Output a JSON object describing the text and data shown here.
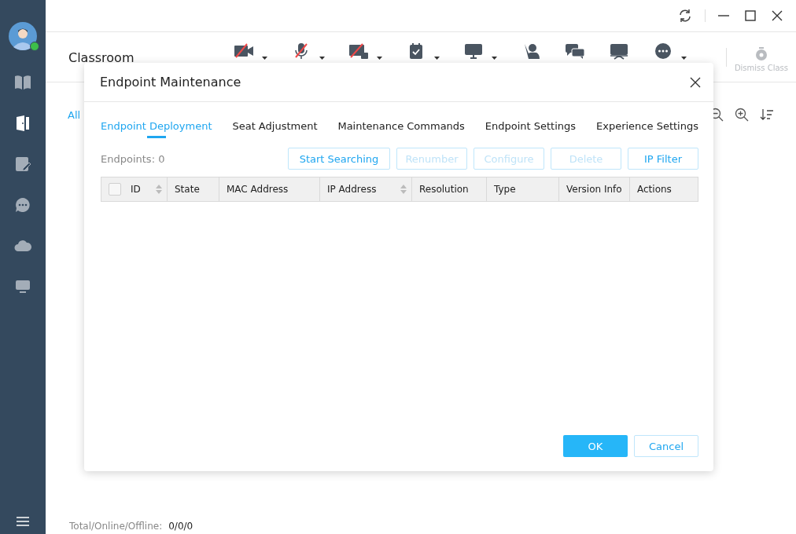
{
  "sidebar": {
    "avatar": {
      "online": true
    },
    "items": [
      {
        "kind": "book",
        "selected": false
      },
      {
        "kind": "door",
        "selected": true
      },
      {
        "kind": "edit",
        "selected": false
      },
      {
        "kind": "chat",
        "selected": false
      },
      {
        "kind": "cloud",
        "selected": false
      },
      {
        "kind": "monitor",
        "selected": false
      }
    ]
  },
  "page": {
    "title": "Classroom",
    "link": "All",
    "toolbar": [
      {
        "kind": "camera-off",
        "dropdown": true
      },
      {
        "kind": "mic-off",
        "dropdown": true
      },
      {
        "kind": "screen-lock",
        "dropdown": true
      },
      {
        "kind": "clipboard",
        "dropdown": true
      },
      {
        "kind": "monitor",
        "dropdown": true
      },
      {
        "kind": "hand",
        "dropdown": false
      },
      {
        "kind": "chat",
        "dropdown": false
      },
      {
        "kind": "projector",
        "dropdown": false
      },
      {
        "kind": "more",
        "dropdown": true
      }
    ],
    "dismiss": {
      "label": "Dismiss Class",
      "disabled": true
    },
    "status": {
      "label": "Total/Online/Offline:",
      "value": "0/0/0"
    }
  },
  "dialog": {
    "title": "Endpoint Maintenance",
    "tabs": [
      {
        "label": "Endpoint Deployment",
        "selected": true
      },
      {
        "label": "Seat Adjustment",
        "selected": false
      },
      {
        "label": "Maintenance Commands",
        "selected": false
      },
      {
        "label": "Endpoint Settings",
        "selected": false
      },
      {
        "label": "Experience Settings",
        "selected": false
      }
    ],
    "count": "Endpoints: 0",
    "buttons": [
      {
        "label": "Start Searching",
        "disabled": false
      },
      {
        "label": "Renumber",
        "disabled": true
      },
      {
        "label": "Configure",
        "disabled": true
      },
      {
        "label": "Delete",
        "disabled": true
      },
      {
        "label": "IP Filter",
        "disabled": false
      }
    ],
    "select_all": {
      "checked": false
    },
    "columns": [
      {
        "label": "ID",
        "sortable": true
      },
      {
        "label": "State",
        "sortable": false
      },
      {
        "label": "MAC Address",
        "sortable": false
      },
      {
        "label": "IP Address",
        "sortable": true
      },
      {
        "label": "Resolution",
        "sortable": false
      },
      {
        "label": "Type",
        "sortable": false
      },
      {
        "label": "Version Info",
        "sortable": false
      },
      {
        "label": "Actions",
        "sortable": false
      }
    ],
    "ok": "OK",
    "cancel": "Cancel"
  }
}
